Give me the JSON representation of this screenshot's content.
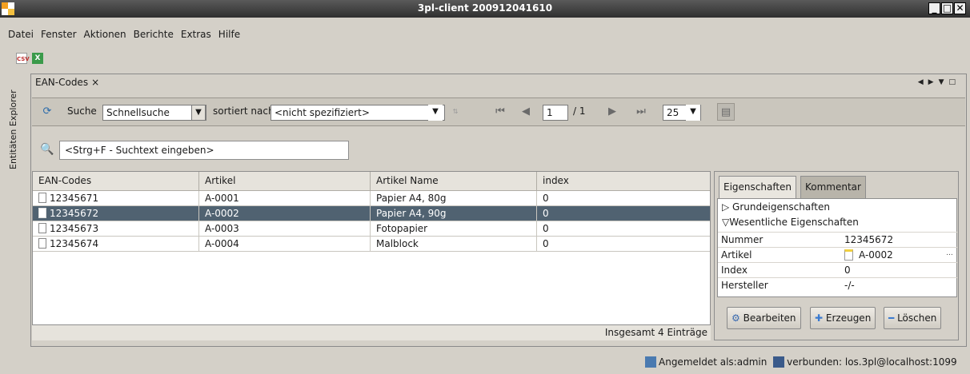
{
  "window": {
    "title": "3pl-client 200912041610"
  },
  "menu": [
    "Datei",
    "Fenster",
    "Aktionen",
    "Berichte",
    "Extras",
    "Hilfe"
  ],
  "toolbar": {
    "icons": [
      "csv-export-icon",
      "excel-export-icon"
    ],
    "csv_label": "CSV",
    "excel_label": "X"
  },
  "left_tab": {
    "label": "Entitäten Explorer"
  },
  "tab": {
    "label": "EAN-Codes",
    "close": "×"
  },
  "search": {
    "label": "Suche",
    "mode": "Schnellsuche",
    "sort_label": "sortiert nach",
    "sort_value": "<nicht spezifiziert>",
    "page": "1",
    "page_total": "/ 1",
    "page_size": "25",
    "filter_placeholder": "<Strg+F - Suchtext eingeben>"
  },
  "table": {
    "columns": [
      "EAN-Codes",
      "Artikel",
      "Artikel Name",
      "index"
    ],
    "rows": [
      [
        "12345671",
        "A-0001",
        "Papier A4, 80g",
        "0"
      ],
      [
        "12345672",
        "A-0002",
        "Papier A4, 90g",
        "0"
      ],
      [
        "12345673",
        "A-0003",
        "Fotopapier",
        "0"
      ],
      [
        "12345674",
        "A-0004",
        "Malblock",
        "0"
      ]
    ],
    "selected_row": 1,
    "footer": "Insgesamt 4 Einträge"
  },
  "props": {
    "tabs": [
      "Eigenschaften",
      "Kommentar"
    ],
    "sections": [
      "Grundeigenschaften",
      "Wesentliche Eigenschaften"
    ],
    "rows": [
      {
        "key": "Nummer",
        "value": "12345672"
      },
      {
        "key": "Artikel",
        "value": "A-0002"
      },
      {
        "key": "Index",
        "value": "0"
      },
      {
        "key": "Hersteller",
        "value": "-/-"
      }
    ],
    "dots": "...",
    "buttons": {
      "edit": "Bearbeiten",
      "create": "Erzeugen",
      "delete": "Löschen"
    }
  },
  "status": {
    "user": "Angemeldet als:admin",
    "connection": "verbunden: los.3pl@localhost:1099"
  }
}
